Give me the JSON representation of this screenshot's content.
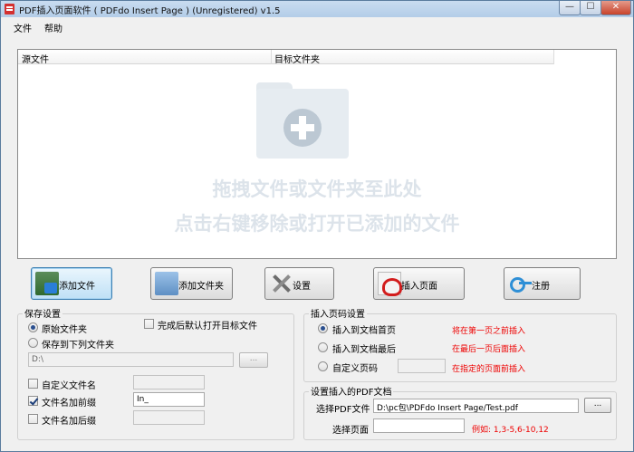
{
  "window": {
    "title": "PDF插入页面软件 ( PDFdo Insert Page )  (Unregistered) v1.5",
    "min_glyph": "—",
    "max_glyph": "☐",
    "close_glyph": "✕"
  },
  "menu": {
    "file": "文件",
    "help": "帮助"
  },
  "file_list": {
    "col_source": "源文件",
    "col_target": "目标文件夹",
    "hint_line1": "拖拽文件或文件夹至此处",
    "hint_line2": "点击右键移除或打开已添加的文件"
  },
  "toolbar": {
    "add_file": "添加文件",
    "add_folder": "添加文件夹",
    "settings": "设置",
    "insert_page": "插入页面",
    "register": "注册"
  },
  "save_settings": {
    "title": "保存设置",
    "original_folder": "原始文件夹",
    "save_to_folder": "保存到下列文件夹",
    "open_target_after": "完成后默认打开目标文件",
    "folder_path": "D:\\",
    "browse": "...",
    "custom_filename": "自定义文件名",
    "add_prefix": "文件名加前缀",
    "prefix_value": "In_",
    "add_suffix": "文件名加后缀",
    "selected": "original_folder",
    "prefix_checked": true,
    "custom_checked": false,
    "suffix_checked": false,
    "open_checked": false
  },
  "page_number_settings": {
    "title": "插入页码设置",
    "insert_first": "插入到文档首页",
    "insert_last": "插入到文档最后",
    "custom_page": "自定义页码",
    "note_first": "将在第一页之前插入",
    "note_last": "在最后一页后面插入",
    "note_custom": "在指定的页面前插入",
    "selected": "insert_first"
  },
  "insert_pdf": {
    "title": "设置插入的PDF文档",
    "select_label": "选择PDF文件",
    "pdf_path": "D:\\pc包\\PDFdo Insert Page/Test.pdf",
    "browse": "...",
    "page_label": "选择页面",
    "page_value": "",
    "page_example": "例如: 1,3-5,6-10,12"
  },
  "colors": {
    "accent": "#3c7fb1",
    "note_red": "#ee0000",
    "hint_gray": "#dce3ea"
  }
}
